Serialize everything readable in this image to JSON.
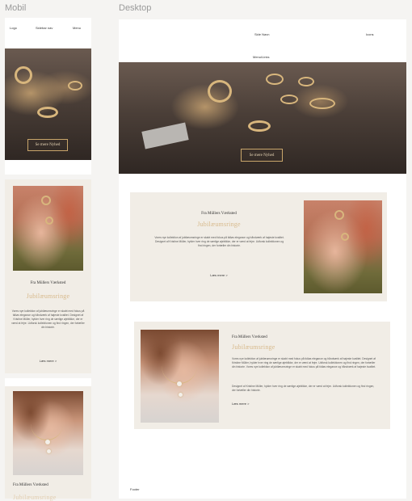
{
  "labels": {
    "mobile": "Mobil",
    "desktop": "Desktop"
  },
  "mobile": {
    "nav": {
      "logo": "Logo",
      "sidebar": "Sidebar nav",
      "menu": "Menu"
    },
    "hero_button": "Se mere Nyhed",
    "card1": {
      "kicker": "Fra Müllers Værksted",
      "title": "Jubilæumsringe",
      "body": "Vores nye kollektion af jubilæumsringe er skabt med fokus på tidløs elegance og håndværk af højeste kvalitet. Designet af Kristine Müller, hylder hver ring de særlige øjeblikke, der er værd at fejre. Udforsk kollektionen og find ringen, der fortæller din historie.",
      "link": "Læs mere >"
    },
    "card2": {
      "kicker": "Fra Müllers Værksted",
      "title": "Jubilæumsringe"
    }
  },
  "desktop": {
    "nav": {
      "sidebar": "Side Navn",
      "icons": "Icons",
      "menu": "Menu/Links"
    },
    "hero_button": "Se mere Nyhed",
    "card1": {
      "kicker": "Fra Müllers Værksted",
      "title": "Jubilæumsringe",
      "body": "Vores nye kollektion af jubilæumsringe er skabt med fokus på tidløs elegance og håndværk af højeste kvalitet. Designet af Kristine Müller, hylder hver ring de særlige øjeblikke, der er værd at fejre. Udforsk kollektionen og find ringen, der fortæller din historie.",
      "link": "Læs mere >"
    },
    "card2": {
      "kicker": "Fra Müllers Værksted",
      "title": "Jubilæumsringe",
      "body1": "Vores nye kollektion af jubilæumsringe er skabt med fokus på tidløs elegance og håndværk af højeste kvalitet. Designet af Kristine Müller, hylder hver ring de særlige øjeblikke, der er værd at fejre. Udforsk kollektionen og find ringen, der fortæller din historie. Vores nye kollektion af jubilæumsringe er skabt med fokus på tidløs elegance og håndværk af højeste kvalitet.",
      "body2": "Designet af Kristine Müller, hylder hver ring de særlige øjeblikke, der er værd at fejre. Udforsk kollektionen og find ringen, der fortæller din historie.",
      "link": "Læs mere >"
    },
    "footer": "Footer"
  },
  "colors": {
    "accent_gold": "#d7b98b",
    "card_bg": "#f1ede6",
    "canvas_bg": "#f5f4f2"
  }
}
